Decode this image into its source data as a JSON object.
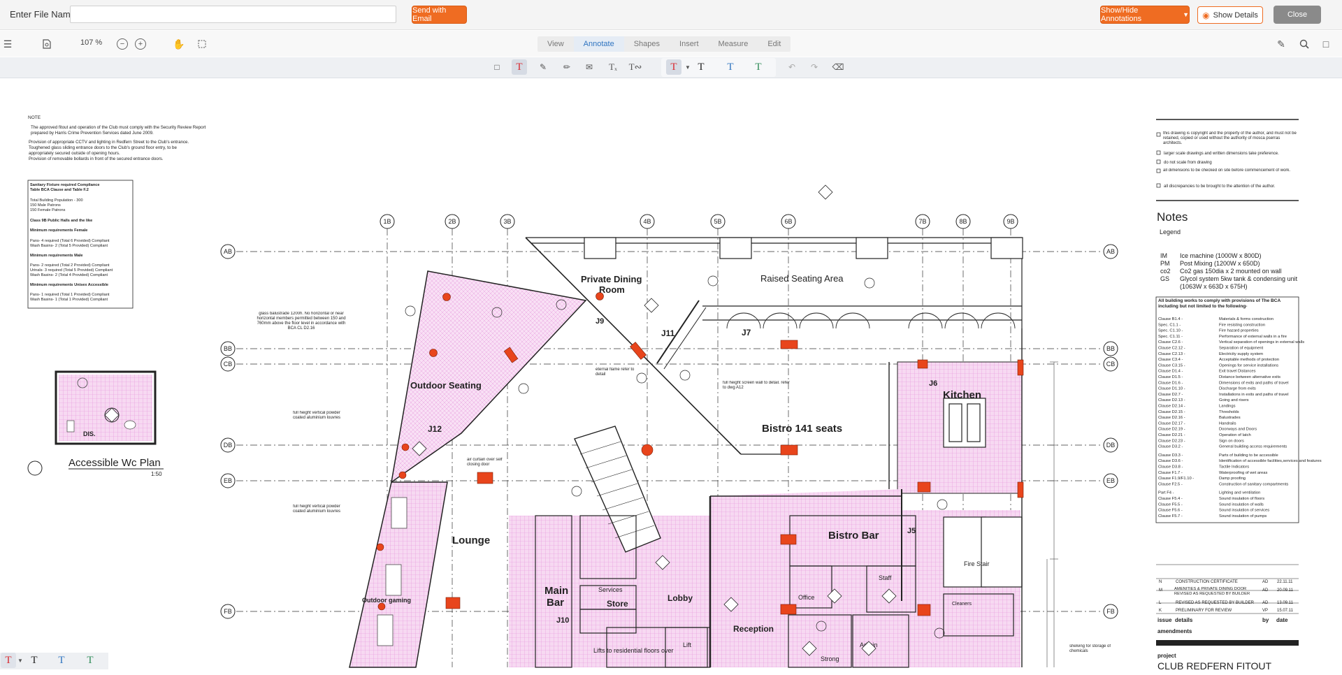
{
  "header": {
    "file_name_label": "Enter File Name",
    "file_name_value": "",
    "send_email_label": "Send with Email",
    "show_hide_label": "Show/Hide Annotations",
    "show_details_label": "Show Details",
    "close_label": "Close"
  },
  "toolbar": {
    "zoom": "107 %",
    "tabs": [
      "View",
      "Annotate",
      "Shapes",
      "Insert",
      "Measure",
      "Edit"
    ],
    "active_tab": "Annotate",
    "colors": {
      "red": "#d9282f",
      "black": "#222222",
      "blue": "#2f74c0",
      "green": "#2e8b57",
      "accent": "#ef6c22"
    }
  },
  "drawing": {
    "note_title": "NOTE",
    "note_lines": [
      "The approved fitout and operation of the Club must comply with the Security Review Report",
      "prepared by Harris Crime Prevention Services dated June 2009.",
      "Provision of appropriate CCTV and lighting in Redfern Street to the Club's entrance.",
      "Toughened glass sliding entrance doors to the Club's ground floor entry, to be",
      "appropriately secured outside of opening hours.",
      "Provision of removable bollards in front of the secured entrance doors."
    ],
    "sanitary_title_1": "Sanitary Fixture required Compliance",
    "sanitary_title_2": "Table BCA  Clause and Table F.2",
    "sanitary_lines": [
      "Total Building Population - 300",
      "150 Male Patrons",
      "150 Female Patrons",
      "Class 9B Public Halls and the like",
      "Minimum requirements Female",
      "Pans- 4 required        (Total 6 Provided)  Compliant",
      "Wash Basins- 2          (Total 5 Provided)  Compliant",
      "Minimum requirements Male",
      "Pans- 2 required        (Total 2 Provided)  Compliant",
      "Urinals- 3 required     (Total 5 Provided)  Compliant",
      "Wash Basins- 2          (Total 4 Provided)  Compliant",
      "Minimum requirements Unisex Accessible",
      "Pans- 1 required        (Total 1 Provided)  Compliant",
      "Wash Basins- 1          (Total 1 Provided)  Compliant"
    ],
    "wc_plan_title": "Accessible Wc Plan",
    "wc_plan_scale": "1:50",
    "grid_top": [
      "1B",
      "2B",
      "3B",
      "4B",
      "5B",
      "6B",
      "7B",
      "8B",
      "9B"
    ],
    "grid_side": [
      "AB",
      "BB",
      "CB",
      "DB",
      "EB",
      "FB"
    ],
    "rooms": {
      "private_dining": "Private Dining",
      "room": "Room",
      "raised_seating": "Raised Seating Area",
      "outdoor_seating": "Outdoor Seating",
      "bistro_seats": "Bistro 141 seats",
      "kitchen": "Kitchen",
      "lounge": "Lounge",
      "bistro_bar": "Bistro Bar",
      "main_bar_1": "Main",
      "main_bar_2": "Bar",
      "services": "Services",
      "store": "Store",
      "lobby": "Lobby",
      "reception": "Reception",
      "office": "Office",
      "staff": "Staff",
      "admin": "Admin",
      "strong": "Strong",
      "fire_stair": "Fire Stair",
      "cleaners": "Cleaners",
      "lifts": "Lifts to residential floors over",
      "outdoor_gaming": "Outdoor gaming",
      "lift": "Lift"
    },
    "labels": {
      "j6": "J6",
      "j7": "J7",
      "j9": "J9",
      "j10": "J10",
      "j11": "J11",
      "j12": "J12",
      "j5": "J5",
      "glass_balustrade": "glass balustrade 1200h. No horizontal or near horizontal members permitted between 150 and 760mm above the floor level in accordance with BCA CL D2.16",
      "louvres_1": "full height vertical powder coated aluminium louvres",
      "louvres_2": "full height vertical powder coated aluminium louvres",
      "air_curtain": "air curtain over self closing door",
      "eternal_flame": "eternal flame refer to detail",
      "screen_wall": "full height screen wall to detail. refer to dwg A12",
      "shelving": "shelving for storage of chemicals"
    },
    "right_panel": {
      "disclaimers": [
        "this drawing is copyright and the property of the author, and must not be retained, copied or used without the authority of mosca pserras architects.",
        "larger scale drawings and written dimensions take preference.",
        "do not scale from drawing",
        "all dimensions to be checked on site before commencement of work.",
        "all discrepancies to be brought to the attention of the author."
      ],
      "notes_title": "Notes",
      "legend_title": "Legend",
      "legend": [
        {
          "code": "IM",
          "desc": "Ice machine (1000W x 800D)"
        },
        {
          "code": "PM",
          "desc": "Post Mixing (1200W x 650D)"
        },
        {
          "code": "co2",
          "desc": "Co2 gas 150dia x 2 mounted on wall"
        },
        {
          "code": "GS",
          "desc": "Glycol system 5kw tank & condensing unit"
        },
        {
          "code": "",
          "desc": "(1063W x 663D x 675H)"
        }
      ],
      "bca_title": "All building works to comply with provisions of The BCA including but not limited to the following-",
      "bca": [
        [
          "Clause B1.4 -",
          "Materials & forms construction"
        ],
        [
          "Spec. C1.1 -",
          "Fire resisting construction"
        ],
        [
          "Spec. C1.10 -",
          "Fire hazard properties"
        ],
        [
          "Spec. C1.11 -",
          "Performance of external walls in a fire"
        ],
        [
          "Clause C2.6 -",
          "Vertical separation of openings in external walls"
        ],
        [
          "Clause C2.12 -",
          "Separation of equipment"
        ],
        [
          "Clause C2.13 -",
          "Electricity supply system"
        ],
        [
          "Clause C3.4 -",
          "Acceptable methods of protection"
        ],
        [
          "Clause C3.15 -",
          "Openings for service installations"
        ],
        [
          "Clause D1.4 -",
          "Exit travel Distances"
        ],
        [
          "Clause D1.5 -",
          "Distance between alternative exits"
        ],
        [
          "Clause D1.6 -",
          "Dimensions of exits and paths of travel"
        ],
        [
          "Clause D1.10 -",
          "Discharge from exits"
        ],
        [
          "Clause D2.7 -",
          "Installations in exits and paths of travel"
        ],
        [
          "Clause D2.13 -",
          "Going and risers"
        ],
        [
          "Clause D2.14 -",
          "Landings"
        ],
        [
          "Clause D2.15 -",
          "Thresholds"
        ],
        [
          "Clause D2.16 -",
          "Balustrades"
        ],
        [
          "Clause D2.17 -",
          "Handrails"
        ],
        [
          "Clause D2.19 -",
          "Doorways and Doors"
        ],
        [
          "Clause D2.21 -",
          "Operation of latch"
        ],
        [
          "Clause D2.23 -",
          "Sign on doors"
        ],
        [
          "Clause D3.2 -",
          "General building access requirements"
        ],
        [
          "Clause D3.3 -",
          "Parts of building to be accessible"
        ],
        [
          "Clause D3.6 -",
          "Identification of accessible facilities,services and features"
        ],
        [
          "Clause D3.8 -",
          "Tactile Indicators"
        ],
        [
          "Clause F1.7 -",
          "Waterproofing of wet areas"
        ],
        [
          "Clause F1.9/F1.10 -",
          "Damp proofing"
        ],
        [
          "Clause F2.5 -",
          "Construction of sanitary compartments"
        ],
        [
          "Part F4 -",
          "Lighting and ventilation"
        ],
        [
          "Clause F5.4 -",
          "Sound insulation of floors"
        ],
        [
          "Clause F5.5 -",
          "Sound insulation of walls"
        ],
        [
          "Clause F5.6 -",
          "Sound insulation of  services"
        ],
        [
          "Clause F5.7 -",
          "Sound insulation of pumps"
        ]
      ],
      "revisions": [
        {
          "issue": "N",
          "details": "CONSTRUCTION CERTIFICATE",
          "by": "AD",
          "date": "22.11.11"
        },
        {
          "issue": "M",
          "details": "AMENITIES & PRIVATE DINING DOOR REVISED AS REQUESTED BY BUILDER",
          "by": "AD",
          "date": "20.09.11"
        },
        {
          "issue": "L",
          "details": "REVISED AS REQUESTED BY BUILDER",
          "by": "AD",
          "date": "13.09.11"
        },
        {
          "issue": "K",
          "details": "PRELIMINARY FOR REVIEW",
          "by": "VP",
          "date": "15.07.11"
        }
      ],
      "rev_headers": {
        "issue": "issue",
        "details": "details",
        "by": "by",
        "date": "date"
      },
      "amendments": "amendments",
      "project_label": "project",
      "project_name": "CLUB REDFERN FITOUT"
    }
  }
}
